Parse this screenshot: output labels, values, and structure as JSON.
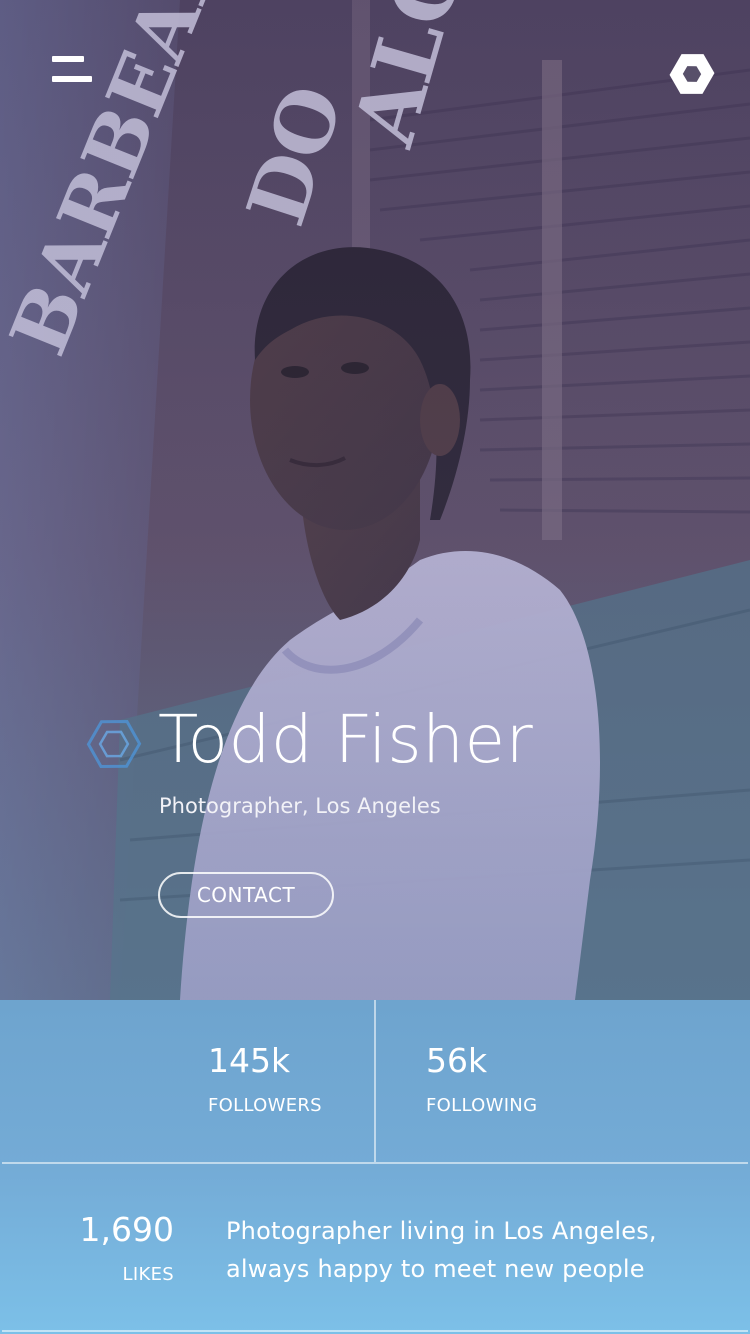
{
  "header": {
    "menu_icon": "menu-icon",
    "settings_icon": "hexagon-settings-icon"
  },
  "profile": {
    "name": "Todd Fisher",
    "subtitle": "Photographer, Los Angeles",
    "contact_label": "CONTACT",
    "badge_icon": "hexagon-icon"
  },
  "stats": {
    "followers": {
      "value": "145k",
      "label": "FOLLOWERS"
    },
    "following": {
      "value": "56k",
      "label": "FOLLOWING"
    },
    "likes": {
      "value": "1,690",
      "label": "LIKES"
    }
  },
  "bio": {
    "line1": "Photographer living in Los Angeles,",
    "line2": "always happy to meet new people"
  },
  "colors": {
    "hero_tint": "#5a4e66",
    "stats_top": "#6ea4ce",
    "stats_bottom": "#7cc0e8",
    "text": "#ffffff"
  },
  "photo_sign_text": "BARBEARIA DO ALCIDES"
}
